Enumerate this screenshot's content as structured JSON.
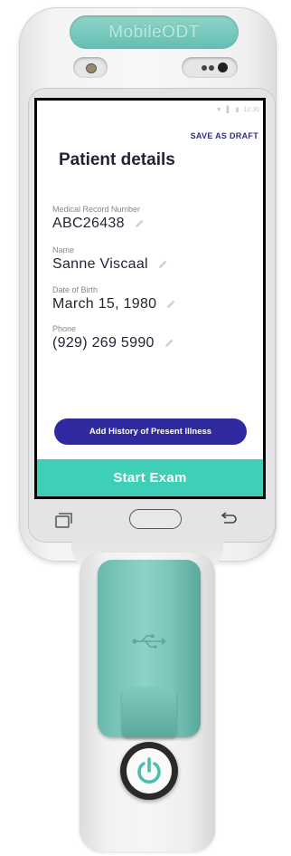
{
  "device": {
    "brand": "MobileODT"
  },
  "statusbar": {
    "time": "12:30"
  },
  "screen": {
    "save_draft_label": "SAVE AS DRAFT",
    "title": "Patient details",
    "fields": [
      {
        "label": "Medical Record Number",
        "value": "ABC26438"
      },
      {
        "label": "Name",
        "value": "Sanne Viscaal"
      },
      {
        "label": "Date of Birth",
        "value": "March 15, 1980"
      },
      {
        "label": "Phone",
        "value": "(929) 269 5990"
      }
    ],
    "hpi_button_label": "Add History of Present Illness",
    "start_button_label": "Start Exam"
  },
  "colors": {
    "accent_teal": "#3dcfb8",
    "primary_indigo": "#2f2aa0",
    "brand_teal": "#64bdb1"
  },
  "icons": {
    "edit": "pencil-icon",
    "recent": "recent-apps-icon",
    "home": "home-icon",
    "back": "back-icon",
    "usb": "usb-icon",
    "power": "power-icon"
  }
}
